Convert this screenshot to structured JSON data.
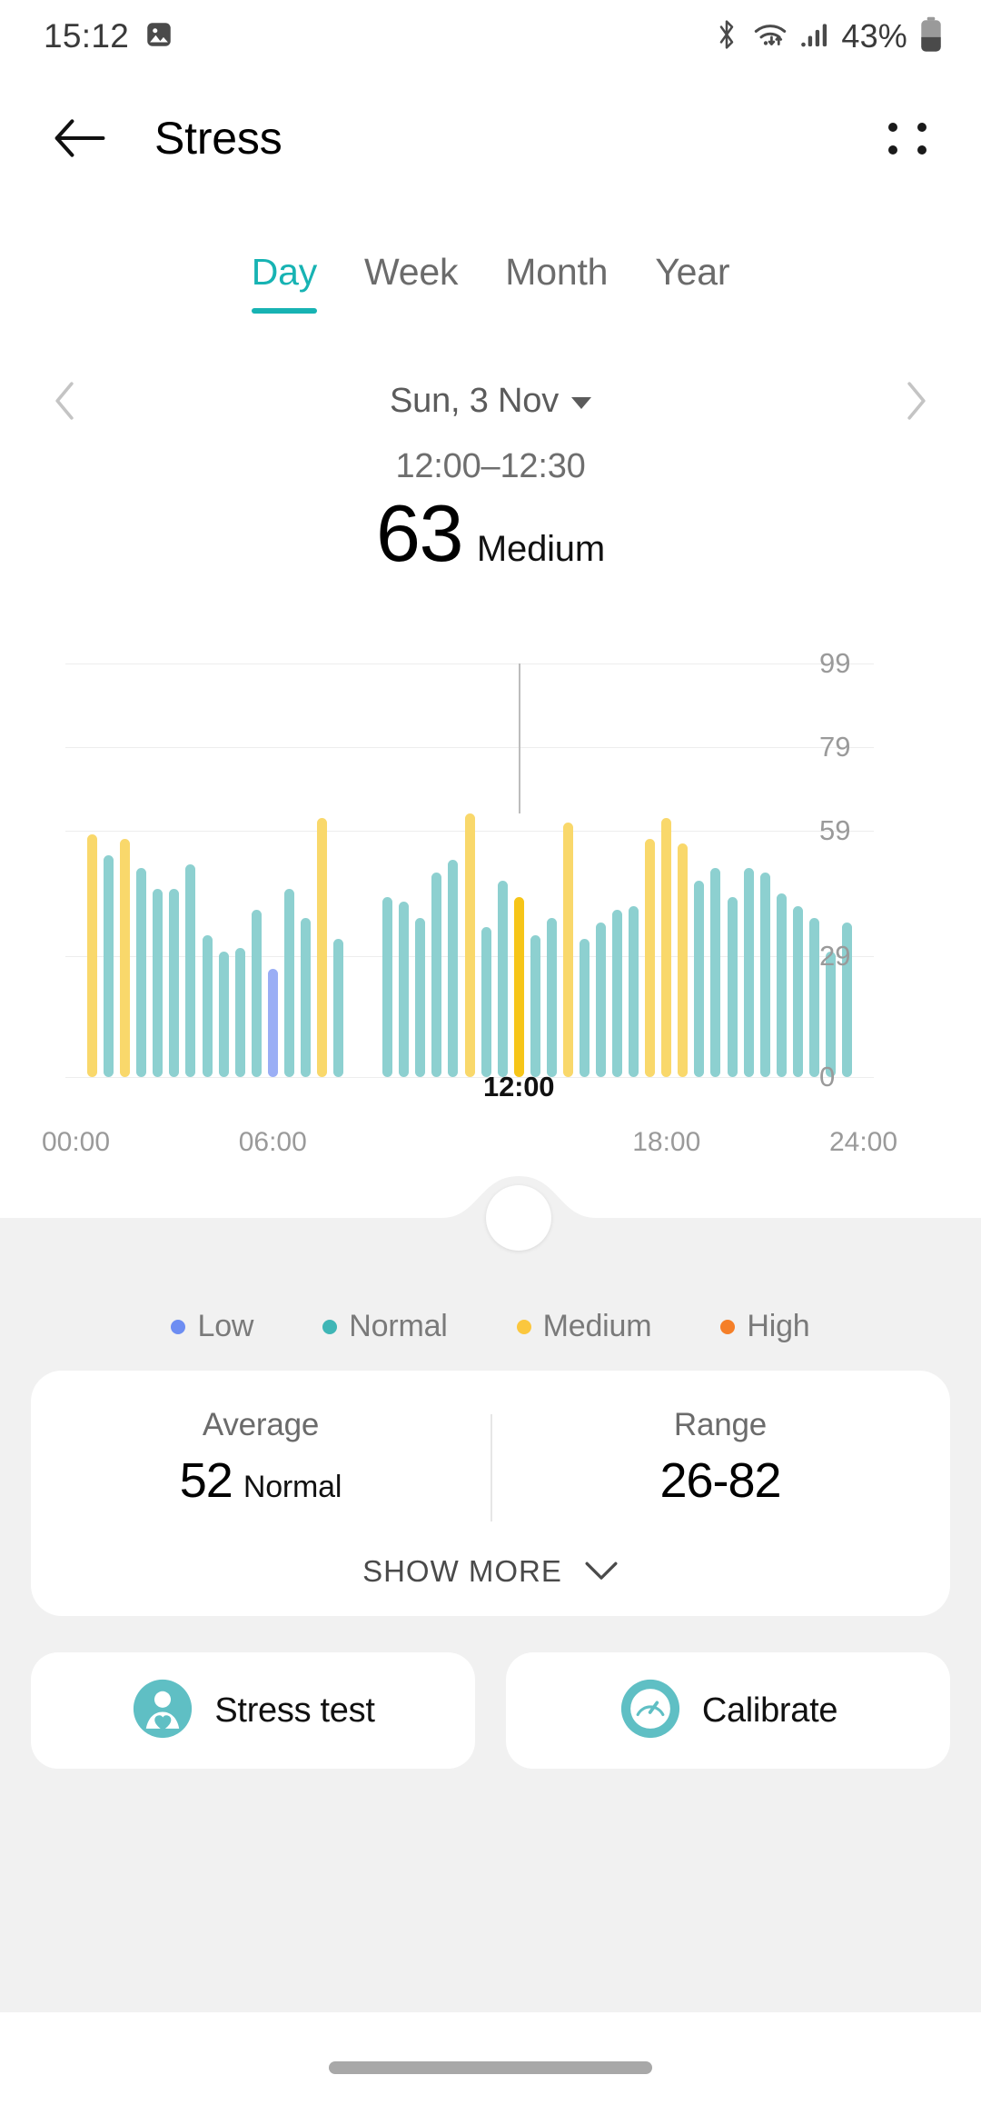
{
  "status_bar": {
    "time": "15:12",
    "battery_percent": "43%",
    "icons": [
      "gallery-image-icon",
      "bluetooth-icon",
      "wifi-icon",
      "cellular-signal-icon",
      "battery-icon"
    ]
  },
  "header": {
    "title": "Stress",
    "back_icon": "back-arrow-icon",
    "menu_icon": "four-dot-menu-icon"
  },
  "tabs": [
    {
      "label": "Day",
      "active": true
    },
    {
      "label": "Week",
      "active": false
    },
    {
      "label": "Month",
      "active": false
    },
    {
      "label": "Year",
      "active": false
    }
  ],
  "date_nav": {
    "prev_icon": "chevron-left-icon",
    "next_icon": "chevron-right-icon",
    "date": "Sun, 3 Nov",
    "dropdown_icon": "caret-down-icon"
  },
  "reading": {
    "time_range": "12:00–12:30",
    "value": "63",
    "level": "Medium"
  },
  "legend": [
    {
      "label": "Low",
      "color": "#6D8DF2"
    },
    {
      "label": "Normal",
      "color": "#3FB6B6"
    },
    {
      "label": "Medium",
      "color": "#FBC73E"
    },
    {
      "label": "High",
      "color": "#F57F28"
    }
  ],
  "stats": {
    "average": {
      "label": "Average",
      "value": "52",
      "level": "Normal"
    },
    "range": {
      "label": "Range",
      "value": "26-82"
    },
    "show_more": "SHOW MORE",
    "show_more_icon": "chevron-down-icon"
  },
  "actions": [
    {
      "label": "Stress test",
      "icon": "person-heart-icon"
    },
    {
      "label": "Calibrate",
      "icon": "gauge-icon"
    }
  ],
  "colors": {
    "accent": "#17B3B3",
    "bar_low": "#9AAEF5",
    "bar_normal": "#8DD0D0",
    "bar_medium": "#F9D86B",
    "bar_selected": "#F6C518",
    "grid": "#EDEDED",
    "page_bg": "#F1F1F1",
    "card_bg": "#FFFFFF"
  },
  "chart_data": {
    "type": "bar",
    "title": "",
    "xlabel": "",
    "ylabel": "",
    "ylim": [
      0,
      99
    ],
    "grid": true,
    "y_ticks": [
      0,
      29,
      59,
      79,
      99
    ],
    "x_ticks": [
      "00:00",
      "06:00",
      "18:00",
      "24:00"
    ],
    "x_tick_positions": [
      0,
      6,
      18,
      24
    ],
    "selected": {
      "index": 24,
      "time": "12:00",
      "value": 63,
      "level": "Medium"
    },
    "selected_marker_label": "12:00",
    "categories": [
      "00:30",
      "01:00",
      "01:30",
      "02:00",
      "02:30",
      "03:00",
      "03:30",
      "04:00",
      "04:30",
      "05:00",
      "05:30",
      "06:00",
      "06:30",
      "07:00",
      "07:30",
      "08:00",
      "09:30",
      "10:00",
      "10:30",
      "11:00",
      "11:30",
      "12:00",
      "12:30",
      "13:00",
      "13:30",
      "14:00",
      "14:30",
      "15:00",
      "15:30",
      "16:00",
      "16:30",
      "17:00",
      "17:30",
      "18:00",
      "18:30",
      "19:00",
      "19:30",
      "20:00",
      "20:30",
      "21:00",
      "21:30",
      "22:00",
      "22:30",
      "23:00",
      "23:30",
      "24:00"
    ],
    "series": [
      {
        "name": "Stress",
        "values": [
          58,
          53,
          57,
          50,
          45,
          45,
          51,
          34,
          30,
          31,
          40,
          26,
          45,
          38,
          62,
          33,
          43,
          42,
          38,
          49,
          52,
          63,
          36,
          47,
          43,
          34,
          38,
          61,
          33,
          37,
          40,
          41,
          57,
          62,
          56,
          47,
          50,
          43,
          50,
          49,
          44,
          41,
          38,
          30,
          37
        ],
        "levels": [
          "Medium",
          "Normal",
          "Medium",
          "Normal",
          "Normal",
          "Normal",
          "Normal",
          "Normal",
          "Normal",
          "Normal",
          "Normal",
          "Low",
          "Normal",
          "Normal",
          "Medium",
          "Normal",
          "Normal",
          "Normal",
          "Normal",
          "Normal",
          "Normal",
          "Medium",
          "Normal",
          "Normal",
          "Normal",
          "Normal",
          "Normal",
          "Medium",
          "Normal",
          "Normal",
          "Normal",
          "Normal",
          "Medium",
          "Medium",
          "Medium",
          "Normal",
          "Normal",
          "Normal",
          "Normal",
          "Normal",
          "Normal",
          "Normal",
          "Normal",
          "Normal",
          "Normal"
        ]
      }
    ]
  }
}
